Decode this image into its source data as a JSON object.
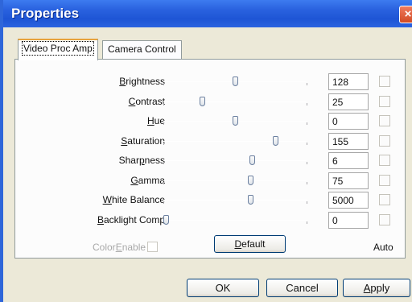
{
  "window": {
    "title": "Properties",
    "close_glyph": "×"
  },
  "tabs": [
    {
      "label": "Video Proc Amp",
      "active": true
    },
    {
      "label": "Camera Control",
      "active": false
    }
  ],
  "controls": [
    {
      "pre": "",
      "key": "B",
      "post": "rightness",
      "value": "128",
      "level": 0.5
    },
    {
      "pre": "",
      "key": "C",
      "post": "ontrast",
      "value": "25",
      "level": 0.26
    },
    {
      "pre": "",
      "key": "H",
      "post": "ue",
      "value": "0",
      "level": 0.5
    },
    {
      "pre": "",
      "key": "S",
      "post": "aturation",
      "value": "155",
      "level": 0.79
    },
    {
      "pre": "Shar",
      "key": "p",
      "post": "ness",
      "value": "6",
      "level": 0.62
    },
    {
      "pre": "",
      "key": "G",
      "post": "amma",
      "value": "75",
      "level": 0.61
    },
    {
      "pre": "",
      "key": "W",
      "post": "hite Balance",
      "value": "5000",
      "level": 0.61
    },
    {
      "pre": "",
      "key": "B",
      "post": "acklight Comp",
      "value": "0",
      "level": 0.0
    }
  ],
  "color_enable": {
    "pre": "Color",
    "key": "E",
    "post": "nable"
  },
  "default_button": {
    "key": "D",
    "post": "efault"
  },
  "auto_label": "Auto",
  "buttons": {
    "ok": "OK",
    "cancel": "Cancel",
    "apply_key": "A",
    "apply_post": "pply"
  }
}
